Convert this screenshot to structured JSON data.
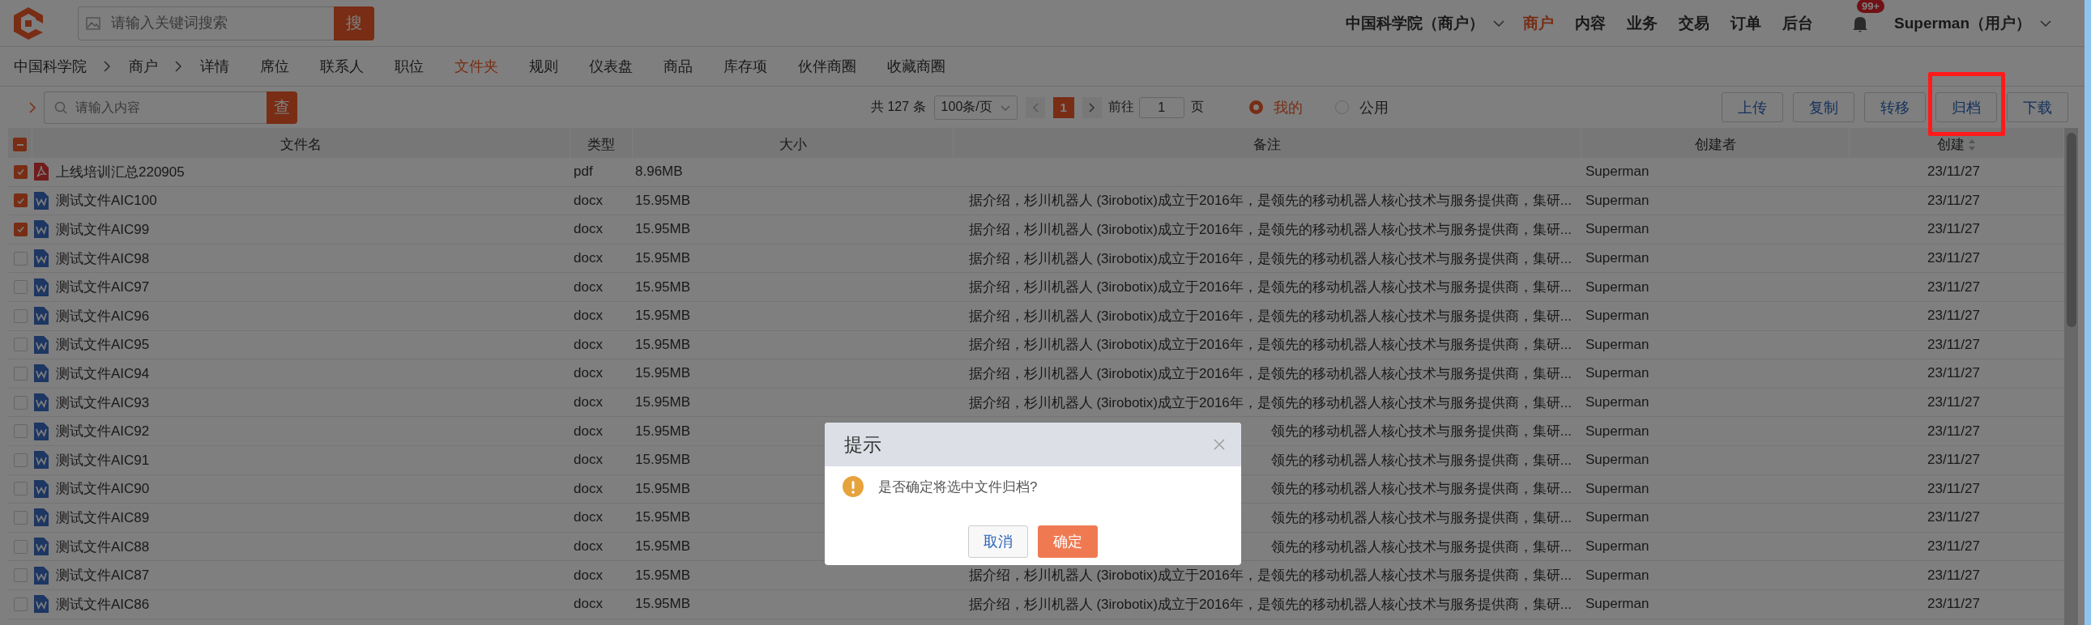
{
  "top_bar": {
    "search": {
      "placeholder": "请输入关键词搜索",
      "button": "搜"
    },
    "org_menu": "中国科学院（商户）",
    "nav": [
      {
        "label": "商户",
        "selected": true
      },
      {
        "label": "内容",
        "selected": false
      },
      {
        "label": "业务",
        "selected": false
      },
      {
        "label": "交易",
        "selected": false
      },
      {
        "label": "订单",
        "selected": false
      },
      {
        "label": "后台",
        "selected": false
      }
    ],
    "notification_badge": "99+",
    "user_menu": "Superman（用户）"
  },
  "breadcrumb": [
    "中国科学院",
    "商户"
  ],
  "tabs": [
    {
      "label": "详情",
      "selected": false
    },
    {
      "label": "席位",
      "selected": false
    },
    {
      "label": "联系人",
      "selected": false
    },
    {
      "label": "职位",
      "selected": false
    },
    {
      "label": "文件夹",
      "selected": true
    },
    {
      "label": "规则",
      "selected": false
    },
    {
      "label": "仪表盘",
      "selected": false
    },
    {
      "label": "商品",
      "selected": false
    },
    {
      "label": "库存项",
      "selected": false
    },
    {
      "label": "伙伴商圈",
      "selected": false
    },
    {
      "label": "收藏商圈",
      "selected": false
    }
  ],
  "toolbar": {
    "filter": {
      "placeholder": "请输入内容",
      "button": "查"
    },
    "pagination": {
      "total": "共 127 条",
      "page_size": "100条/页",
      "current_page": "1",
      "goto_label": "前往",
      "goto_value": "1",
      "goto_unit": "页"
    },
    "scope": [
      {
        "label": "我的",
        "selected": true
      },
      {
        "label": "公用",
        "selected": false
      }
    ],
    "buttons": [
      {
        "label": "上传",
        "highlighted": false
      },
      {
        "label": "复制",
        "highlighted": false
      },
      {
        "label": "转移",
        "highlighted": false
      },
      {
        "label": "归档",
        "highlighted": true
      },
      {
        "label": "下载",
        "highlighted": false
      }
    ]
  },
  "table": {
    "select_all_indeterminate": true,
    "columns": [
      {
        "label": "文件名",
        "sortable": false
      },
      {
        "label": "类型",
        "sortable": false
      },
      {
        "label": "大小",
        "sortable": false
      },
      {
        "label": "备注",
        "sortable": false
      },
      {
        "label": "创建者",
        "sortable": false
      },
      {
        "label": "创建",
        "sortable": true
      }
    ],
    "rows": [
      {
        "checked": true,
        "kind": "pdf",
        "name": "上线培训汇总220905",
        "type": "pdf",
        "size": "8.96MB",
        "remark": "",
        "creator": "Superman",
        "created": "23/11/27"
      },
      {
        "checked": true,
        "kind": "word",
        "name": "测试文件AIC100",
        "type": "docx",
        "size": "15.95MB",
        "remark": "据介绍，杉川机器人 (3irobotix)成立于2016年，是领先的移动机器人核心技术与服务提供商，集研...",
        "creator": "Superman",
        "created": "23/11/27"
      },
      {
        "checked": true,
        "kind": "word",
        "name": "测试文件AIC99",
        "type": "docx",
        "size": "15.95MB",
        "remark": "据介绍，杉川机器人 (3irobotix)成立于2016年，是领先的移动机器人核心技术与服务提供商，集研...",
        "creator": "Superman",
        "created": "23/11/27"
      },
      {
        "checked": false,
        "kind": "word",
        "name": "测试文件AIC98",
        "type": "docx",
        "size": "15.95MB",
        "remark": "据介绍，杉川机器人 (3irobotix)成立于2016年，是领先的移动机器人核心技术与服务提供商，集研...",
        "creator": "Superman",
        "created": "23/11/27"
      },
      {
        "checked": false,
        "kind": "word",
        "name": "测试文件AIC97",
        "type": "docx",
        "size": "15.95MB",
        "remark": "据介绍，杉川机器人 (3irobotix)成立于2016年，是领先的移动机器人核心技术与服务提供商，集研...",
        "creator": "Superman",
        "created": "23/11/27"
      },
      {
        "checked": false,
        "kind": "word",
        "name": "测试文件AIC96",
        "type": "docx",
        "size": "15.95MB",
        "remark": "据介绍，杉川机器人 (3irobotix)成立于2016年，是领先的移动机器人核心技术与服务提供商，集研...",
        "creator": "Superman",
        "created": "23/11/27"
      },
      {
        "checked": false,
        "kind": "word",
        "name": "测试文件AIC95",
        "type": "docx",
        "size": "15.95MB",
        "remark": "据介绍，杉川机器人 (3irobotix)成立于2016年，是领先的移动机器人核心技术与服务提供商，集研...",
        "creator": "Superman",
        "created": "23/11/27"
      },
      {
        "checked": false,
        "kind": "word",
        "name": "测试文件AIC94",
        "type": "docx",
        "size": "15.95MB",
        "remark": "据介绍，杉川机器人 (3irobotix)成立于2016年，是领先的移动机器人核心技术与服务提供商，集研...",
        "creator": "Superman",
        "created": "23/11/27"
      },
      {
        "checked": false,
        "kind": "word",
        "name": "测试文件AIC93",
        "type": "docx",
        "size": "15.95MB",
        "remark": "据介绍，杉川机器人 (3irobotix)成立于2016年，是领先的移动机器人核心技术与服务提供商，集研...",
        "creator": "Superman",
        "created": "23/11/27"
      },
      {
        "checked": false,
        "kind": "word",
        "name": "测试文件AIC92",
        "type": "docx",
        "size": "15.95MB",
        "remark": "领先的移动机器人核心技术与服务提供商，集研...",
        "creator": "Superman",
        "created": "23/11/27"
      },
      {
        "checked": false,
        "kind": "word",
        "name": "测试文件AIC91",
        "type": "docx",
        "size": "15.95MB",
        "remark": "领先的移动机器人核心技术与服务提供商，集研...",
        "creator": "Superman",
        "created": "23/11/27"
      },
      {
        "checked": false,
        "kind": "word",
        "name": "测试文件AIC90",
        "type": "docx",
        "size": "15.95MB",
        "remark": "领先的移动机器人核心技术与服务提供商，集研...",
        "creator": "Superman",
        "created": "23/11/27"
      },
      {
        "checked": false,
        "kind": "word",
        "name": "测试文件AIC89",
        "type": "docx",
        "size": "15.95MB",
        "remark": "领先的移动机器人核心技术与服务提供商，集研...",
        "creator": "Superman",
        "created": "23/11/27"
      },
      {
        "checked": false,
        "kind": "word",
        "name": "测试文件AIC88",
        "type": "docx",
        "size": "15.95MB",
        "remark": "领先的移动机器人核心技术与服务提供商，集研...",
        "creator": "Superman",
        "created": "23/11/27"
      },
      {
        "checked": false,
        "kind": "word",
        "name": "测试文件AIC87",
        "type": "docx",
        "size": "15.95MB",
        "remark": "据介绍，杉川机器人 (3irobotix)成立于2016年，是领先的移动机器人核心技术与服务提供商，集研...",
        "creator": "Superman",
        "created": "23/11/27"
      },
      {
        "checked": false,
        "kind": "word",
        "name": "测试文件AIC86",
        "type": "docx",
        "size": "15.95MB",
        "remark": "据介绍，杉川机器人 (3irobotix)成立于2016年，是领先的移动机器人核心技术与服务提供商，集研...",
        "creator": "Superman",
        "created": "23/11/27"
      }
    ]
  },
  "dialog": {
    "title": "提示",
    "message": "是否确定将选中文件归档?",
    "buttons": [
      {
        "kind": "cancel",
        "label": "取消"
      },
      {
        "kind": "confirm",
        "label": "确定"
      }
    ]
  }
}
